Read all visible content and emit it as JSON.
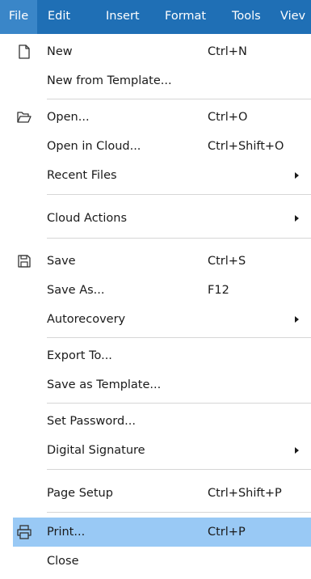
{
  "menubar": {
    "items": [
      {
        "label": "File"
      },
      {
        "label": "Edit"
      },
      {
        "label": "Insert"
      },
      {
        "label": "Format"
      },
      {
        "label": "Tools"
      },
      {
        "label": "Viev"
      }
    ]
  },
  "menu": {
    "items": [
      {
        "label": "New",
        "shortcut": "Ctrl+N",
        "icon": "new-document-icon"
      },
      {
        "label": "New from Template..."
      },
      {
        "label": "Open...",
        "shortcut": "Ctrl+O",
        "icon": "folder-open-icon"
      },
      {
        "label": "Open in Cloud...",
        "shortcut": "Ctrl+Shift+O"
      },
      {
        "label": "Recent Files",
        "submenu": true
      },
      {
        "label": "Cloud Actions",
        "submenu": true
      },
      {
        "label": "Save",
        "shortcut": "Ctrl+S",
        "icon": "save-icon"
      },
      {
        "label": "Save As...",
        "shortcut": "F12"
      },
      {
        "label": "Autorecovery",
        "submenu": true
      },
      {
        "label": "Export To..."
      },
      {
        "label": "Save as Template..."
      },
      {
        "label": "Set Password..."
      },
      {
        "label": "Digital Signature",
        "submenu": true
      },
      {
        "label": "Page Setup",
        "shortcut": "Ctrl+Shift+P"
      },
      {
        "label": "Print...",
        "shortcut": "Ctrl+P",
        "icon": "printer-icon",
        "highlighted": true
      },
      {
        "label": "Close"
      }
    ]
  },
  "colors": {
    "menubar_bg": "#1f6fb5",
    "active_tab": "#3a86c8",
    "highlight": "#99c9f5"
  }
}
